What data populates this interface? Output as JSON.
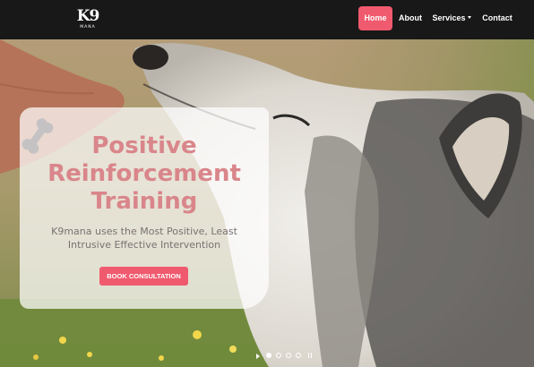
{
  "brand": {
    "logo_text": "K9",
    "logo_subtext": "MANA"
  },
  "nav": {
    "items": [
      {
        "label": "Home",
        "active": true
      },
      {
        "label": "About"
      },
      {
        "label": "Services",
        "has_dropdown": true
      },
      {
        "label": "Contact"
      }
    ]
  },
  "hero": {
    "title_line1": "Positive",
    "title_line2": "Reinforcement",
    "title_line3": "Training",
    "subtitle": "K9mana uses the Most Positive, Least Intrusive Effective Intervention",
    "cta_label": "BOOK CONSULTATION",
    "decor_icon": "bone-icon"
  },
  "carousel": {
    "slide_count": 4,
    "active_slide": 1
  },
  "colors": {
    "accent": "#f05a6e",
    "title": "#d9868b",
    "subtitle": "#7a7172",
    "navbar": "#181818"
  }
}
